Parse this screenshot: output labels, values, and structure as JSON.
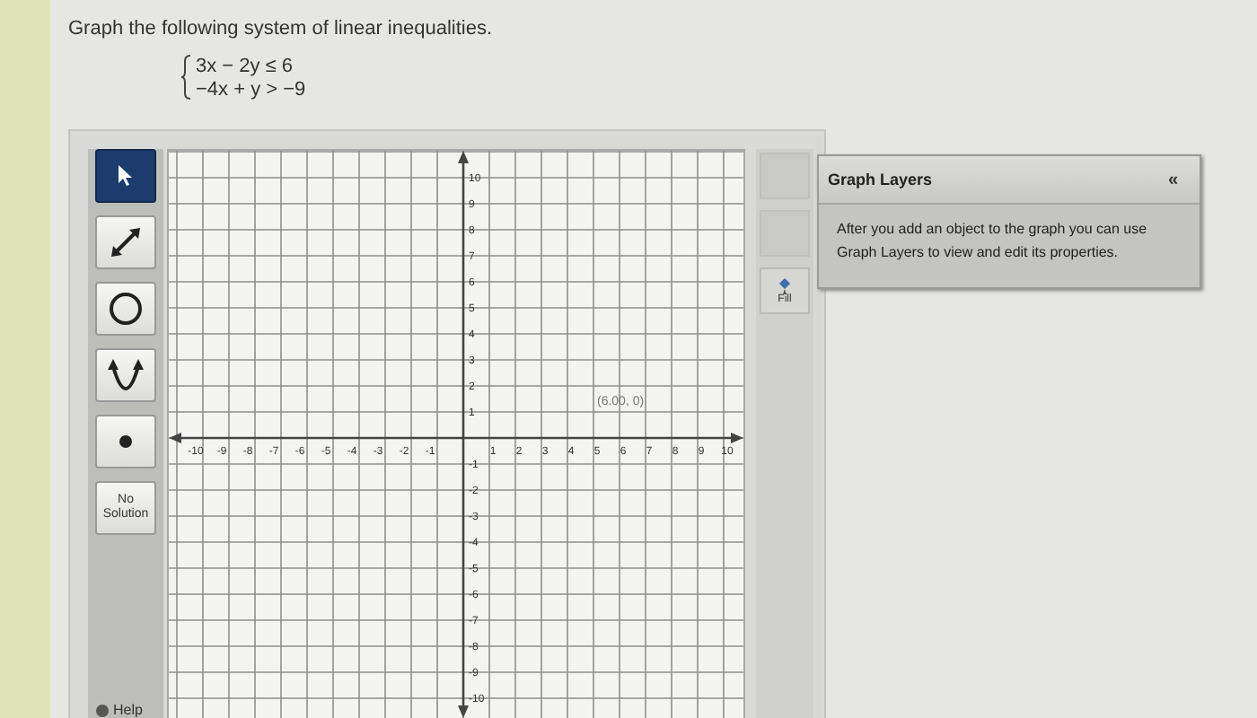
{
  "question": {
    "prompt": "Graph the following system of linear inequalities.",
    "system": [
      "3x − 2y ≤ 6",
      "−4x + y > −9"
    ]
  },
  "tools": [
    {
      "kind": "pointer",
      "selected": true
    },
    {
      "kind": "line",
      "selected": false
    },
    {
      "kind": "circle",
      "selected": false
    },
    {
      "kind": "parabola",
      "selected": false
    },
    {
      "kind": "point",
      "selected": false
    },
    {
      "kind": "text",
      "label": "No Solution",
      "selected": false
    }
  ],
  "help": "Help",
  "graph": {
    "x_labels": [
      "-10",
      "-9",
      "-8",
      "-7",
      "-6",
      "-5",
      "-4",
      "-3",
      "-2",
      "-1",
      "1",
      "2",
      "3",
      "4",
      "5",
      "6",
      "7",
      "8",
      "9",
      "10"
    ],
    "y_labels": [
      "10",
      "9",
      "8",
      "7",
      "6",
      "5",
      "4",
      "3",
      "2",
      "1",
      "-1",
      "-2",
      "-3",
      "-4",
      "-5",
      "-6",
      "-7",
      "-8",
      "-9",
      "-10"
    ],
    "cursor_readout": "(6.00, 0)"
  },
  "side_tools": [
    {
      "kind": "blank",
      "disabled": true
    },
    {
      "kind": "blank",
      "disabled": true
    },
    {
      "kind": "fill",
      "label": "Fill",
      "disabled": false
    }
  ],
  "layers": {
    "title": "Graph Layers",
    "collapse": "«",
    "message": "After you add an object to the graph you can use Graph Layers to view and edit its properties."
  }
}
